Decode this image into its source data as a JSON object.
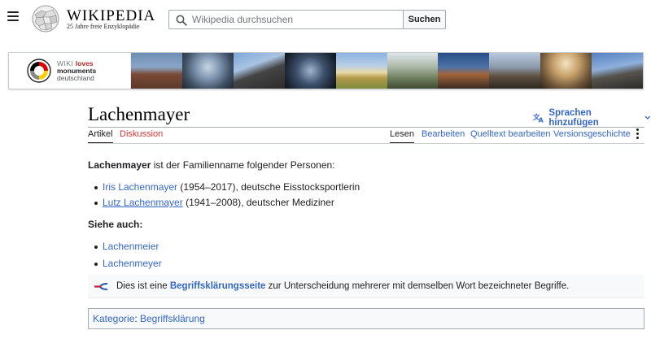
{
  "header": {
    "wordmark": "WIKIPEDIA",
    "tagline": "25 Jahre freie Enzyklopädie",
    "search_placeholder": "Wikipedia durchsuchen",
    "search_button": "Suchen"
  },
  "banner": {
    "line1_wiki": "WIKI",
    "line1_loves": "loves",
    "line2": "monuments",
    "line3": "deutschland"
  },
  "title": "Lachenmayer",
  "language_button": "Sprachen hinzufügen",
  "tabs": {
    "article": "Artikel",
    "discussion": "Diskussion",
    "read": "Lesen",
    "edit": "Bearbeiten",
    "source_edit": "Quelltext bearbeiten",
    "history": "Versionsgeschichte"
  },
  "content": {
    "intro_bold": "Lachenmayer",
    "intro_rest": " ist der Familienname folgender Personen:",
    "people": [
      {
        "name": "Iris Lachenmayer",
        "desc": " (1954–2017), deutsche Eisstocksportlerin"
      },
      {
        "name": "Lutz Lachenmayer",
        "desc": " (1941–2008), deutscher Mediziner"
      }
    ],
    "see_also": "Siehe auch:",
    "see_also_links": [
      "Lachenmeier",
      "Lachenmeyer"
    ]
  },
  "disambiguation": {
    "prefix": "Dies ist eine ",
    "link": "Begriffsklärungsseite",
    "suffix": " zur Unterscheidung mehrerer mit demselben Wort bezeichneter Begriffe."
  },
  "category": {
    "label": "Kategorie",
    "colon": ":",
    "item": "Begriffsklärung"
  },
  "colors": {
    "link": "#3366cc",
    "redlink": "#d73333",
    "border": "#a2a9b1"
  },
  "icons": [
    "menu-icon",
    "wikipedia-globe-icon",
    "search-icon",
    "translate-icon",
    "chevron-down-icon",
    "more-icon",
    "disambiguation-icon"
  ]
}
